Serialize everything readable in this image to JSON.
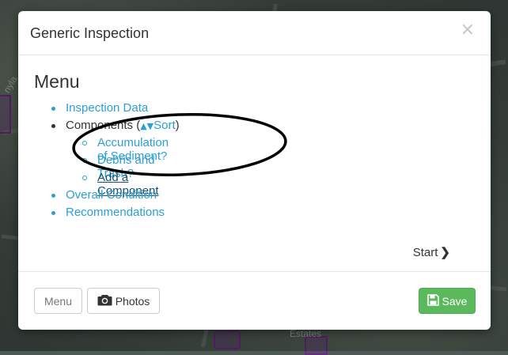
{
  "background": {
    "map_labels": [
      "nyla",
      "Estates"
    ]
  },
  "modal": {
    "title": "Generic Inspection",
    "close_label": "×",
    "heading": "Menu",
    "menu_items": [
      {
        "label": "Inspection Data"
      },
      {
        "label": "Components (",
        "sort_label": "Sort",
        "close_paren": ")"
      },
      {
        "label": "Overall Condition"
      },
      {
        "label": "Recommendations"
      }
    ],
    "components": [
      {
        "label": "Accumulation of Sediment?"
      },
      {
        "label": "Debris and Trash?"
      }
    ],
    "add_component_label": "Add a Component",
    "start_label": "Start",
    "footer": {
      "menu_label": "Menu",
      "photos_label": "Photos",
      "save_label": "Save"
    }
  },
  "colors": {
    "link": "#2a9fd6",
    "save_button": "#5cb85c",
    "map_polygon": "#6b2a86"
  },
  "icons": [
    "close-icon",
    "sort-icon",
    "chevron-right-icon",
    "camera-icon",
    "save-icon"
  ]
}
